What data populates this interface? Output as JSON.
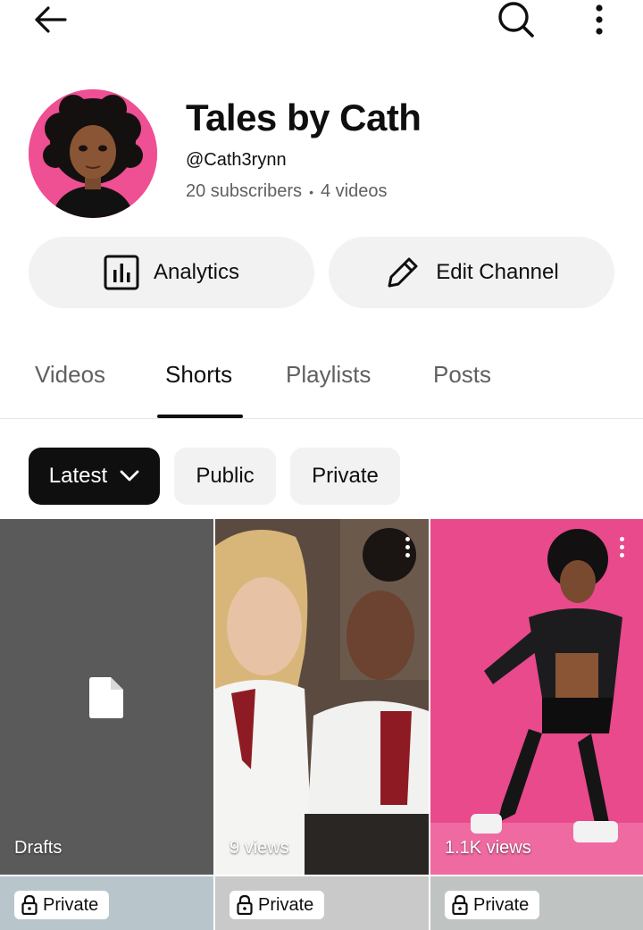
{
  "topbar": {
    "back_icon": "arrow-left-icon",
    "search_icon": "search-icon",
    "more_icon": "more-vertical-icon"
  },
  "channel": {
    "name": "Tales by Cath",
    "handle": "@Cath3rynn",
    "subscribers": "20 subscribers",
    "separator": "•",
    "videos": "4 videos",
    "avatar_bg": "#ef4f93"
  },
  "actions": {
    "analytics_label": "Analytics",
    "edit_label": "Edit Channel"
  },
  "tabs": [
    {
      "label": "Videos",
      "active": false
    },
    {
      "label": "Shorts",
      "active": true
    },
    {
      "label": "Playlists",
      "active": false
    },
    {
      "label": "Posts",
      "active": false
    }
  ],
  "filters": [
    {
      "label": "Latest",
      "selected": true
    },
    {
      "label": "Public",
      "selected": false
    },
    {
      "label": "Private",
      "selected": false
    }
  ],
  "shorts": [
    {
      "label": "Drafts",
      "icon": "draft-file-icon",
      "bg": "#5a5a5a"
    },
    {
      "label": "9 views",
      "bg": "#4a3f38"
    },
    {
      "label": "1.1K views",
      "bg": "#e84a8c"
    }
  ],
  "shorts_row2": [
    {
      "badge": "Private"
    },
    {
      "badge": "Private"
    },
    {
      "badge": "Private"
    }
  ]
}
